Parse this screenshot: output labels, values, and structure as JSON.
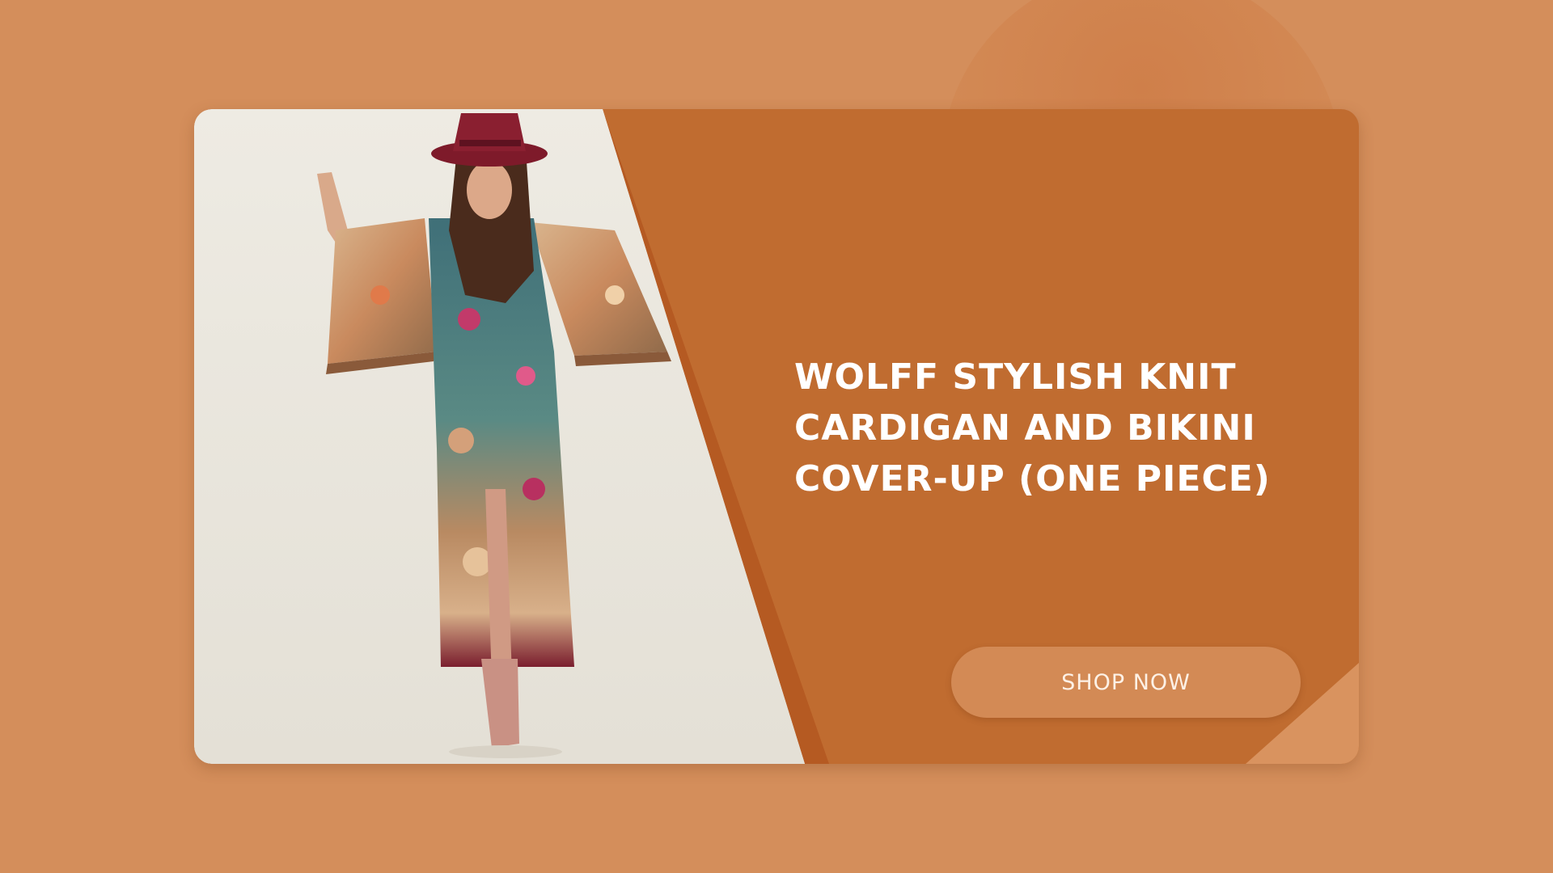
{
  "banner": {
    "product_title": "WOLFF STYLISH KNIT CARDIGAN AND BIKINI COVER-UP (ONE PIECE)",
    "cta_label": "SHOP NOW",
    "image_subject": "model wearing floral kimono cardigan with burgundy hat"
  },
  "colors": {
    "page_background": "#d48e5b",
    "card_background": "#c06c30",
    "accent_stripe": "#b55a22",
    "button_background": "#d38a55",
    "text": "#ffffff"
  }
}
